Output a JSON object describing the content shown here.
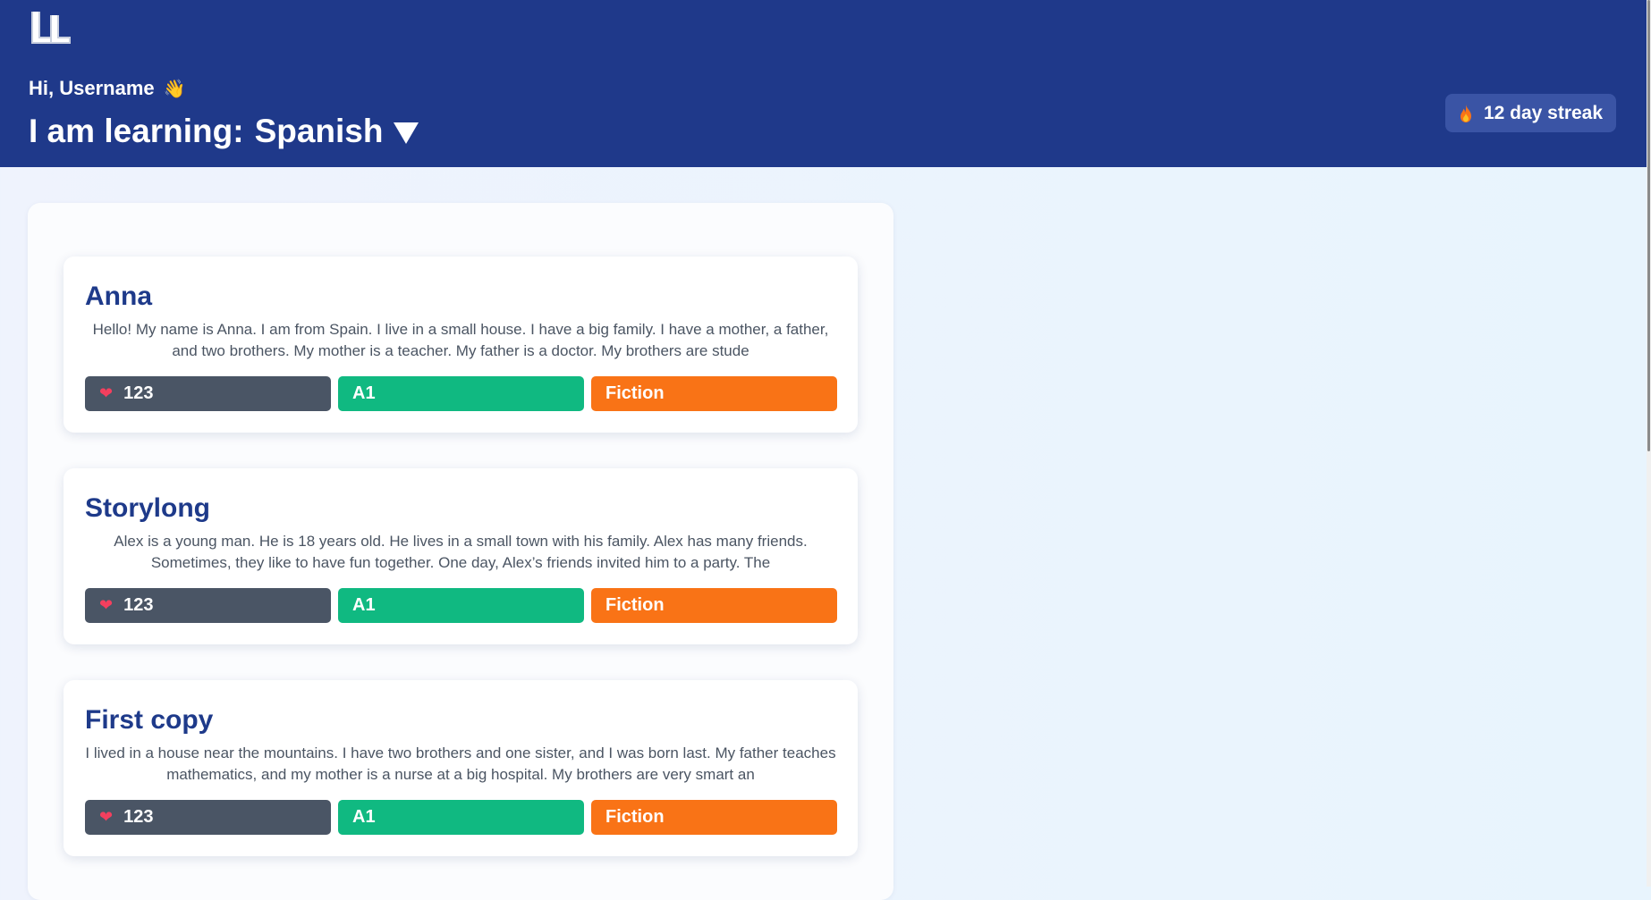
{
  "header": {
    "greeting": "Hi, Username",
    "wave_emoji": "👋",
    "learning_prefix": "I am learning:",
    "language": "Spanish",
    "streak": "12 day streak",
    "bg_color": "#1f398a"
  },
  "stories": [
    {
      "title": "Anna",
      "excerpt": "Hello! My name is Anna. I am from Spain. I live in a small house. I have a big family. I have a mother, a father, and two brothers. My mother is a teacher. My father is a doctor. My brothers are stude",
      "likes": "123",
      "level": "A1",
      "genre": "Fiction"
    },
    {
      "title": "Storylong",
      "excerpt": "Alex is a young man. He is 18 years old. He lives in a small town with his family. Alex has many friends. Sometimes, they like to have fun together. One day, Alex’s friends invited him to a party. The",
      "likes": "123",
      "level": "A1",
      "genre": "Fiction"
    },
    {
      "title": "First copy",
      "excerpt": "I lived in a house near the mountains. I have two brothers and one sister, and I was born last. My father teaches mathematics, and my mother is a nurse at a big hospital. My brothers are very smart an",
      "likes": "123",
      "level": "A1",
      "genre": "Fiction"
    }
  ],
  "icons": {
    "logo": "app-logo",
    "flame": "flame-icon",
    "heart": "heart-icon",
    "caret": "caret-down-icon"
  },
  "colors": {
    "likes_tag": "#4a5565",
    "level_tag": "#10b981",
    "genre_tag": "#f97316",
    "title": "#1e3a8a"
  }
}
